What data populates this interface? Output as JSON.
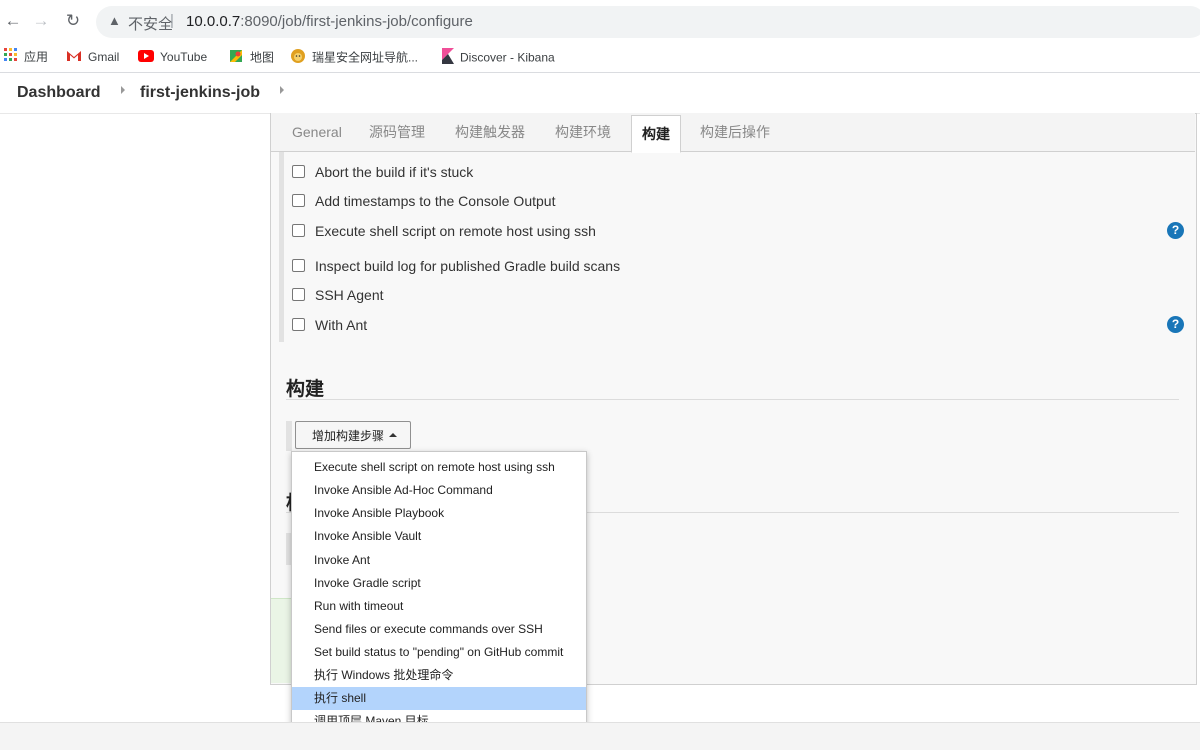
{
  "browser": {
    "url_warning": "不安全",
    "url": "10.0.0.7:8090/job/first-jenkins-job/configure",
    "url_host": "10.0.0.7",
    "url_path": ":8090/job/first-jenkins-job/configure",
    "bookmarks": [
      "应用",
      "Gmail",
      "YouTube",
      "地图",
      "瑞星安全网址导航...",
      "Discover - Kibana"
    ]
  },
  "breadcrumb": {
    "items": [
      "Dashboard",
      "first-jenkins-job"
    ]
  },
  "tabs": [
    "General",
    "源码管理",
    "构建触发器",
    "构建环境",
    "构建",
    "构建后操作"
  ],
  "active_tab": "构建",
  "build_env": {
    "options": [
      "Abort the build if it's stuck",
      "Add timestamps to the Console Output",
      "Execute shell script on remote host using ssh",
      "Inspect build log for published Gradle build scans",
      "SSH Agent",
      "With Ant"
    ],
    "help_symbol": "?"
  },
  "build_section": {
    "title": "构建",
    "add_step_label": "增加构建步骤",
    "next_title_fragment": "构"
  },
  "menu": {
    "items": [
      "Execute shell script on remote host using ssh",
      "Invoke Ansible Ad-Hoc Command",
      "Invoke Ansible Playbook",
      "Invoke Ansible Vault",
      "Invoke Ant",
      "Invoke Gradle script",
      "Run with timeout",
      "Send files or execute commands over SSH",
      "Set build status to \"pending\" on GitHub commit",
      "执行 Windows 批处理命令",
      "执行 shell",
      "调用顶层 Maven 目标"
    ],
    "highlighted": "执行 shell"
  },
  "colors": {
    "accent": "#1976b8",
    "highlight": "#b3d4fc"
  }
}
